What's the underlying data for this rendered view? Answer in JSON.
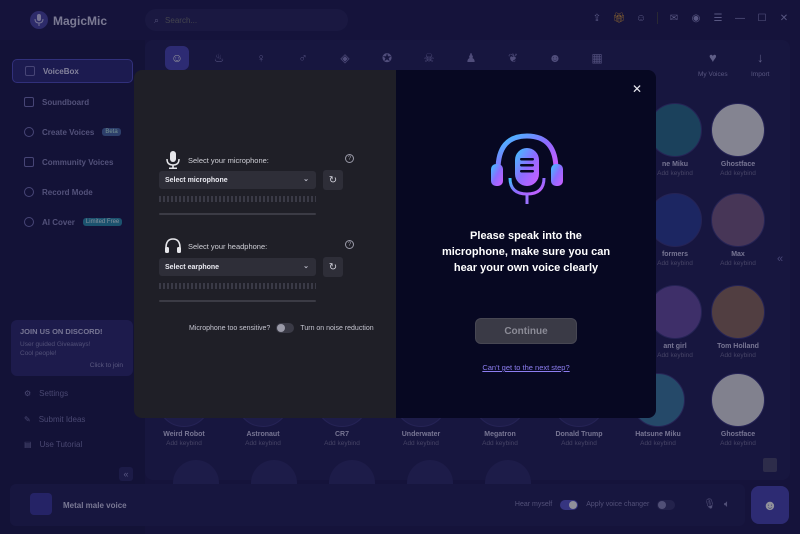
{
  "app": {
    "title": "MagicMic"
  },
  "search": {
    "placeholder": "Search..."
  },
  "sidebar": {
    "items": [
      {
        "label": "VoiceBox",
        "active": true,
        "icon": "voicebox-icon"
      },
      {
        "label": "Soundboard",
        "icon": "soundboard-icon"
      },
      {
        "label": "Create Voices",
        "badge": "Beta",
        "icon": "create-voices-icon"
      },
      {
        "label": "Community Voices",
        "icon": "community-icon"
      },
      {
        "label": "Record Mode",
        "icon": "record-icon"
      },
      {
        "label": "AI Cover",
        "badge": "Limited Free",
        "icon": "ai-cover-icon"
      }
    ],
    "discord": {
      "title": "JOIN US ON DISCORD!",
      "subtitle": "User guided Giveaways! Cool people!",
      "join": "Click to join"
    },
    "bottom": [
      {
        "label": "Settings"
      },
      {
        "label": "Submit Ideas"
      },
      {
        "label": "Use Tutorial"
      }
    ]
  },
  "main": {
    "my_voices": "My Voices",
    "import": "Import",
    "right_column": [
      {
        "name": "ne Miku",
        "keybind": "Add keybind"
      },
      {
        "name": "Ghostface",
        "keybind": "Add keybind"
      },
      {
        "name": "formers",
        "keybind": "Add keybind"
      },
      {
        "name": "Max",
        "keybind": "Add keybind"
      },
      {
        "name": "ant girl",
        "keybind": "Add keybind"
      },
      {
        "name": "Tom Holland",
        "keybind": "Add keybind"
      }
    ],
    "bottom_row": [
      {
        "name": "Weird Robot",
        "keybind": "Add keybind"
      },
      {
        "name": "Astronaut",
        "keybind": "Add keybind"
      },
      {
        "name": "CR7",
        "keybind": "Add keybind"
      },
      {
        "name": "Underwater",
        "keybind": "Add keybind"
      },
      {
        "name": "Megatron",
        "keybind": "Add keybind"
      },
      {
        "name": "Donald Trump",
        "keybind": "Add keybind"
      },
      {
        "name": "Hatsune Miku",
        "keybind": "Add keybind"
      },
      {
        "name": "Ghostface",
        "keybind": "Add keybind"
      }
    ]
  },
  "bottombar": {
    "voice_name": "Metal male voice",
    "hear_myself": "Hear myself",
    "apply_changer": "Apply voice changer"
  },
  "modal": {
    "mic_label": "Select your microphone:",
    "mic_select": "Select microphone",
    "headphone_label": "Select your headphone:",
    "headphone_select": "Select earphone",
    "sensitive": "Microphone too sensitive?",
    "noise": "Turn on noise reduction",
    "prompt": "Please speak into the microphone, make sure you can hear your own voice clearly",
    "continue": "Continue",
    "next_step": "Can't get to the next step?"
  }
}
